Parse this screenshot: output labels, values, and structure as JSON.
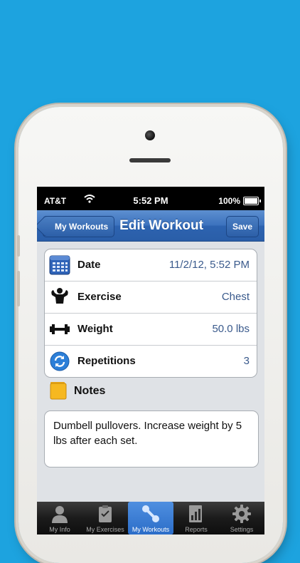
{
  "status_bar": {
    "carrier": "AT&T",
    "time": "5:52 PM",
    "battery": "100%",
    "battery_level": 1.0
  },
  "nav": {
    "back_label": "My Workouts",
    "title": "Edit Workout",
    "save_label": "Save"
  },
  "fields": [
    {
      "label": "Date",
      "value": "11/2/12, 5:52 PM",
      "icon": "calendar-icon"
    },
    {
      "label": "Exercise",
      "value": "Chest",
      "icon": "muscle-icon"
    },
    {
      "label": "Weight",
      "value": "50.0 lbs",
      "icon": "dumbbell-icon"
    },
    {
      "label": "Repetitions",
      "value": "3",
      "icon": "repeat-icon"
    }
  ],
  "notes": {
    "label": "Notes",
    "text": "Dumbell pullovers. Increase weight by 5 lbs after each set."
  },
  "tabs": [
    {
      "label": "My Info",
      "icon": "person-icon"
    },
    {
      "label": "My Exercises",
      "icon": "clipboard-icon"
    },
    {
      "label": "My Workouts",
      "icon": "workout-icon",
      "active": true
    },
    {
      "label": "Reports",
      "icon": "report-icon"
    },
    {
      "label": "Settings",
      "icon": "gear-icon"
    }
  ],
  "colors": {
    "background": "#1da3df",
    "nav_bar": "#3d73be",
    "value_text": "#3a5a8c",
    "active_tab": "#2b6dc8"
  }
}
